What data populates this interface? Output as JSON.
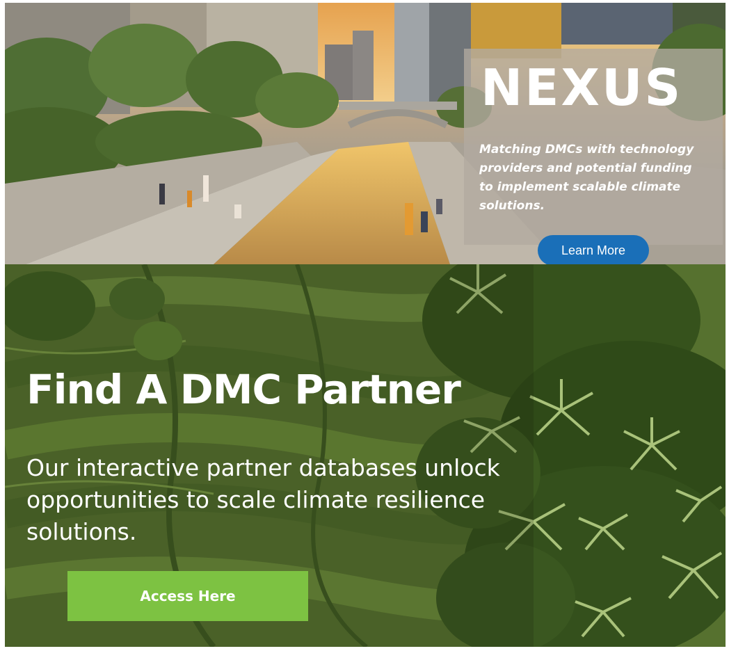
{
  "nexus": {
    "title": "NEXUS",
    "description": "Matching DMCs with technology providers and potential funding to implement scalable climate solutions.",
    "button_label": "Learn More"
  },
  "dmc": {
    "title": "Find A DMC Partner",
    "subtitle": "Our interactive partner databases unlock opportunities to scale climate resilience solutions.",
    "button_label": "Access Here"
  },
  "colors": {
    "learn_more_button": "#1a6fb8",
    "access_button": "#7dc242"
  }
}
